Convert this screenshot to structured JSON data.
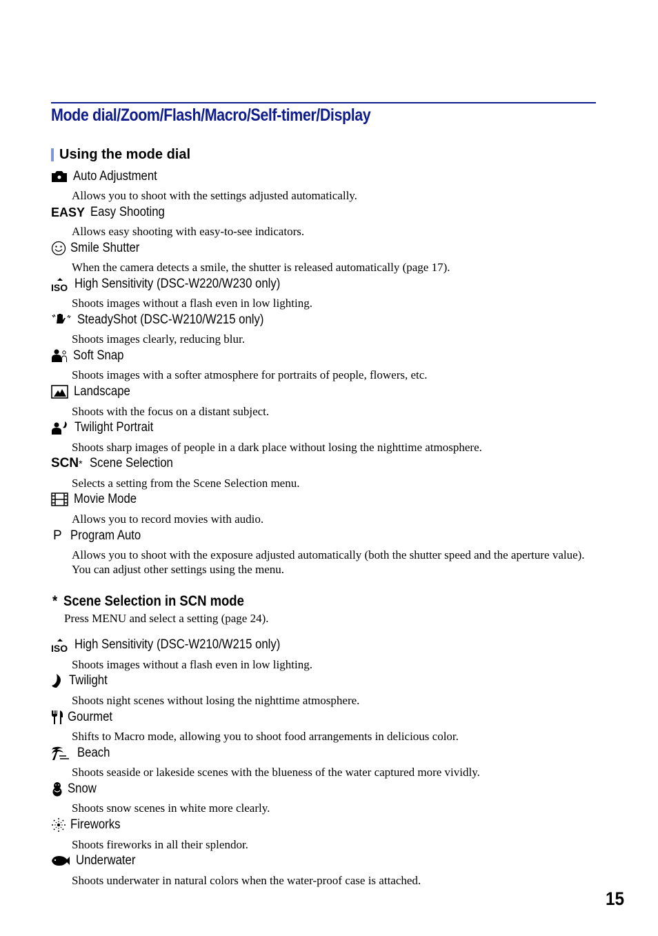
{
  "page_title": "Mode dial/Zoom/Flash/Macro/Self-timer/Display",
  "section_heading": "Using the mode dial",
  "accent_colors": {
    "title": "#0d1b8c",
    "section_bar": "#7f95d4"
  },
  "mode_dial_items": [
    {
      "icon": "camera-icon",
      "label": "Auto Adjustment",
      "description": "Allows you to shoot with the settings adjusted automatically."
    },
    {
      "icon": "easy-icon",
      "icon_text": "EASY",
      "label": "Easy Shooting",
      "description": "Allows easy shooting with easy-to-see indicators."
    },
    {
      "icon": "smile-icon",
      "label": "Smile Shutter",
      "description": "When the camera detects a smile, the shutter is released automatically (page 17)."
    },
    {
      "icon": "iso-icon",
      "label": "High Sensitivity (DSC-W220/W230 only)",
      "description": "Shoots images without a flash even in low lighting."
    },
    {
      "icon": "steadyshot-hand-icon",
      "label": "SteadyShot (DSC-W210/W215 only)",
      "description": "Shoots images clearly, reducing blur."
    },
    {
      "icon": "soft-snap-icon",
      "label": "Soft Snap",
      "description": "Shoots images with a softer atmosphere for portraits of people, flowers, etc."
    },
    {
      "icon": "landscape-icon",
      "label": "Landscape",
      "description": "Shoots with the focus on a distant subject."
    },
    {
      "icon": "twilight-portrait-icon",
      "label": "Twilight Portrait",
      "description": "Shoots sharp images of people in a dark place without losing the nighttime atmosphere."
    },
    {
      "icon": "scn-icon",
      "icon_text": "SCN",
      "icon_suffix": "*",
      "label": "Scene Selection",
      "description": "Selects a setting from the Scene Selection menu."
    },
    {
      "icon": "movie-icon",
      "label": "Movie Mode",
      "description": "Allows you to record movies with audio."
    },
    {
      "icon": "program-auto-icon",
      "icon_text": "P",
      "label": "Program Auto",
      "description": "Allows you to shoot with the exposure adjusted automatically (both the shutter speed and the aperture value). You can adjust other settings using the menu."
    }
  ],
  "note": {
    "star": "*",
    "heading": "Scene Selection in SCN mode",
    "text": "Press MENU and select a setting (page 24)."
  },
  "scene_items": [
    {
      "icon": "iso-icon",
      "label": "High Sensitivity (DSC-W210/W215 only)",
      "description": "Shoots images without a flash even in low lighting."
    },
    {
      "icon": "moon-icon",
      "label": "Twilight",
      "description": "Shoots night scenes without losing the nighttime atmosphere."
    },
    {
      "icon": "gourmet-icon",
      "label": "Gourmet",
      "description": "Shifts to Macro mode, allowing you to shoot food arrangements in delicious color."
    },
    {
      "icon": "beach-icon",
      "label": "Beach",
      "description": "Shoots seaside or lakeside scenes with the blueness of the water captured more vividly."
    },
    {
      "icon": "snow-icon",
      "label": "Snow",
      "description": "Shoots snow scenes in white more clearly."
    },
    {
      "icon": "fireworks-icon",
      "label": "Fireworks",
      "description": "Shoots fireworks in all their splendor."
    },
    {
      "icon": "underwater-icon",
      "label": "Underwater",
      "description": "Shoots underwater in natural colors when the water-proof case is attached."
    }
  ],
  "page_number": "15"
}
